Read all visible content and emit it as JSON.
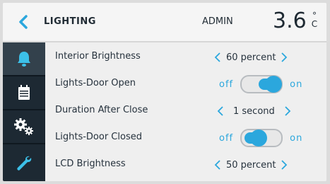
{
  "header": {
    "back_icon": "chevron-left-icon",
    "title": "LIGHTING",
    "user": "ADMIN",
    "temperature": "3.6",
    "temperature_unit_degree": "°",
    "temperature_unit_letter": "C"
  },
  "sidebar": {
    "items": [
      {
        "icon": "bell-icon",
        "active": true
      },
      {
        "icon": "calendar-icon",
        "active": false
      },
      {
        "icon": "gears-icon",
        "active": false
      },
      {
        "icon": "wrench-icon",
        "active": false
      }
    ]
  },
  "settings": [
    {
      "label": "Interior Brightness",
      "type": "stepper",
      "value": "60 percent"
    },
    {
      "label": "Lights-Door Open",
      "type": "toggle",
      "off_label": "off",
      "on_label": "on",
      "state": "on"
    },
    {
      "label": "Duration After Close",
      "type": "stepper",
      "value": "1 second"
    },
    {
      "label": "Lights-Door Closed",
      "type": "toggle",
      "off_label": "off",
      "on_label": "on",
      "state": "partial"
    },
    {
      "label": "LCD Brightness",
      "type": "stepper",
      "value": "50 percent"
    }
  ],
  "colors": {
    "accent": "#2ba7dd",
    "sidebar": "#1d2933",
    "text": "#26323d"
  }
}
